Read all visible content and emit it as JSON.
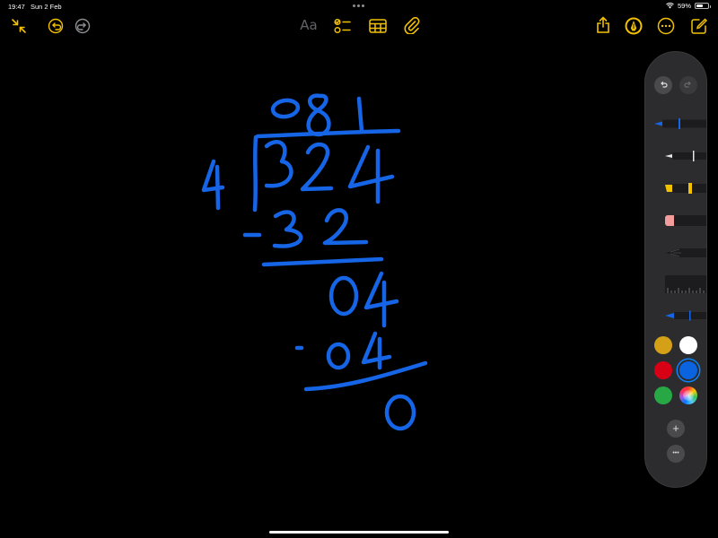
{
  "status_bar": {
    "time": "19:47",
    "date": "Sun 2 Feb",
    "battery_percent": 59,
    "battery_label": "59%"
  },
  "toolbar": {
    "text_format_label": "Aa",
    "left_icons": [
      "collapse-arrows-icon",
      "undo-icon",
      "redo-icon"
    ],
    "center_icons": [
      "checklist-icon",
      "table-icon",
      "paperclip-icon"
    ],
    "right_icons": [
      "share-icon",
      "markup-pen-icon",
      "more-icon",
      "compose-icon"
    ],
    "accent_color": "#f2c100",
    "inactive_color": "#636366"
  },
  "handwriting": {
    "ink_color": "#1565e6",
    "quotient": "081",
    "divisor": "4",
    "dividend": "324",
    "step1_subtract": "-32",
    "step1_remainder": "04",
    "step2_subtract": "-04",
    "final_remainder": "0"
  },
  "palette": {
    "tools": [
      "pen-tool",
      "monoline-tool",
      "highlighter-tool",
      "eraser-tool",
      "pencil-tool",
      "ruler-tool",
      "fountain-pen-tool"
    ],
    "selected_tool": "pen-tool",
    "colors": [
      "#d4a017",
      "#ffffff",
      "#d70015",
      "#0a64e0",
      "#28a745",
      "color-wheel"
    ],
    "selected_color": "#0a64e0",
    "add_label": "+",
    "more_label": "•••"
  }
}
